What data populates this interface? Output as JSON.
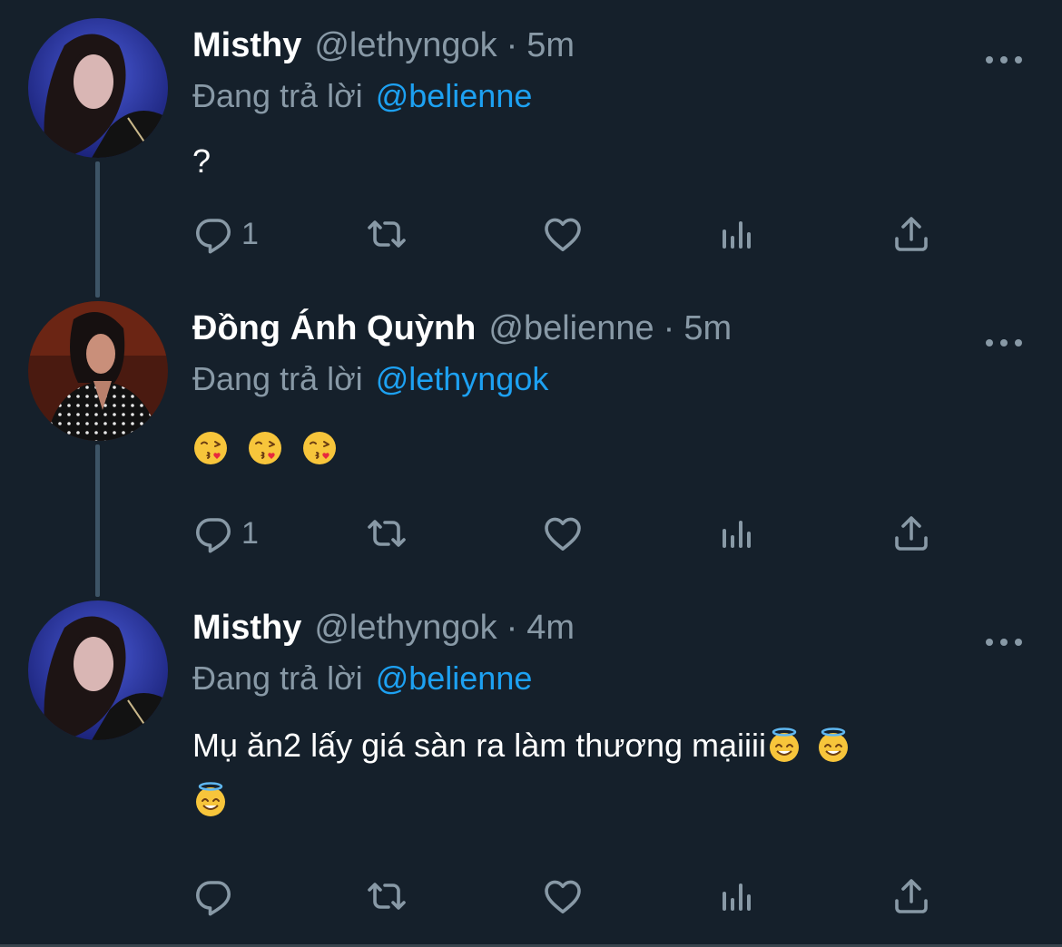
{
  "tweets": [
    {
      "display_name": "Misthy",
      "handle": "@lethyngok",
      "separator": "·",
      "time": "5m",
      "reply_prefix": "Đang trả lời",
      "reply_target": "@belienne",
      "text": "?",
      "reply_count": "1",
      "avatar": "woman-blue-lighting-photo"
    },
    {
      "display_name": "Đồng Ánh Quỳnh",
      "handle": "@belienne",
      "separator": "·",
      "time": "5m",
      "reply_prefix": "Đang trả lời",
      "reply_target": "@lethyngok",
      "emojis": [
        "face-blowing-kiss",
        "face-blowing-kiss",
        "face-blowing-kiss"
      ],
      "reply_count": "1",
      "avatar": "woman-polka-dot-photo"
    },
    {
      "display_name": "Misthy",
      "handle": "@lethyngok",
      "separator": "·",
      "time": "4m",
      "reply_prefix": "Đang trả lời",
      "reply_target": "@belienne",
      "text": "Mụ ăn2 lấy giá sàn ra làm thương mạiiii",
      "emojis": [
        "smiling-face-with-halo",
        "smiling-face-with-halo",
        "smiling-face-with-halo"
      ],
      "reply_count": "",
      "avatar": "woman-blue-lighting-photo"
    }
  ],
  "action_icons": [
    "reply-icon",
    "retweet-icon",
    "like-icon",
    "analytics-icon",
    "share-icon"
  ],
  "colors": {
    "background": "#15202b",
    "primary_text": "#ffffff",
    "secondary_text": "#8899a6",
    "link": "#1da1f2",
    "thread_line": "#3d5466"
  }
}
